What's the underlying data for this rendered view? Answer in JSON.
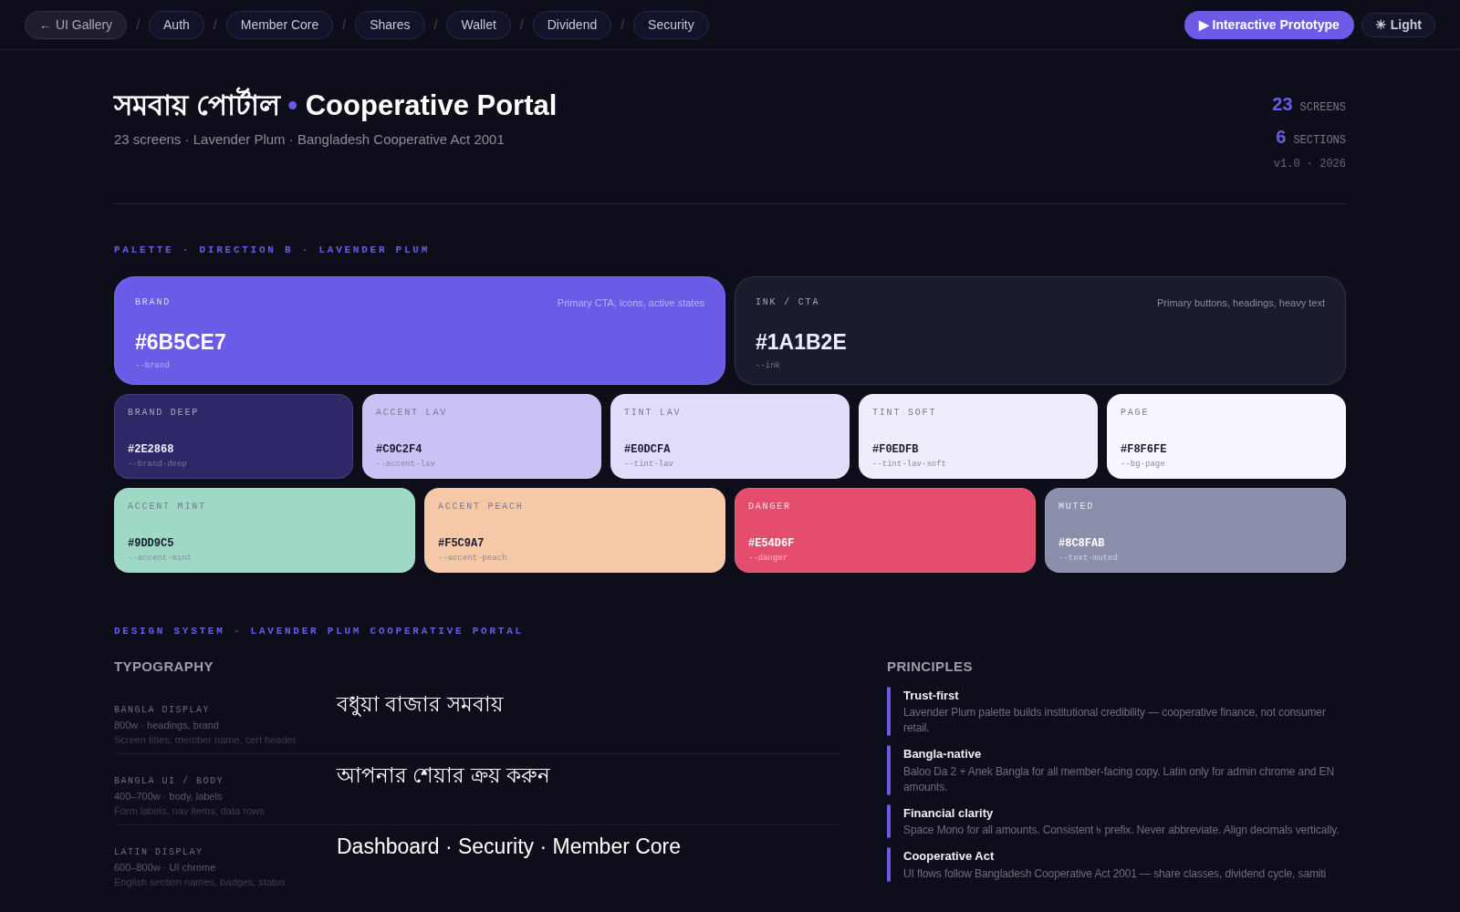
{
  "nav": {
    "items": [
      {
        "kind": "back",
        "label": "← UI Gallery"
      },
      {
        "kind": "sep",
        "label": "/"
      },
      {
        "kind": "link",
        "label": "Auth"
      },
      {
        "kind": "sep",
        "label": "/"
      },
      {
        "kind": "link",
        "label": "Member Core"
      },
      {
        "kind": "sep",
        "label": "/"
      },
      {
        "kind": "link",
        "label": "Shares"
      },
      {
        "kind": "sep",
        "label": "/"
      },
      {
        "kind": "link",
        "label": "Wallet"
      },
      {
        "kind": "sep",
        "label": "/"
      },
      {
        "kind": "link",
        "label": "Dividend"
      },
      {
        "kind": "sep",
        "label": "/"
      },
      {
        "kind": "link",
        "label": "Security"
      }
    ],
    "prototype_button": {
      "icon": "▶",
      "label": "Interactive Prototype"
    },
    "theme_button": {
      "icon": "☀",
      "label": "Light"
    }
  },
  "header": {
    "title_bangla": "সমবায় পোর্টাল",
    "title_dot": "•",
    "title_latin": "Cooperative Portal",
    "subtitle": "23 screens · Lavender Plum · Bangladesh Cooperative Act 2001",
    "stats": [
      {
        "value": "23",
        "label": "SCREENS"
      },
      {
        "value": "6",
        "label": "SECTIONS"
      }
    ],
    "version": "v1.0 · 2026"
  },
  "palette": {
    "heading": "PALETTE · DIRECTION B · LAVENDER PLUM",
    "primary_swatches": [
      {
        "name": "BRAND",
        "hex": "#6B5CE7",
        "var": "--brand",
        "note": "Primary CTA, icons, active states",
        "color": "#6b5ce7",
        "kind": "brand"
      },
      {
        "name": "INK / CTA",
        "hex": "#1A1B2E",
        "var": "--ink",
        "note": "Primary buttons, headings, heavy text",
        "color": "#1a1b2e",
        "kind": "dark"
      }
    ],
    "tint_swatches": [
      {
        "name": "BRAND DEEP",
        "hex": "#2E2868",
        "var": "--brand-deep",
        "color": "#2e2868",
        "kind": "dark"
      },
      {
        "name": "ACCENT LAV",
        "hex": "#C9C2F4",
        "var": "--accent-lav",
        "color": "#c9c2f4",
        "kind": "light"
      },
      {
        "name": "TINT LAV",
        "hex": "#E0DCFA",
        "var": "--tint-lav",
        "color": "#e0dcfa",
        "kind": "light"
      },
      {
        "name": "TINT SOFT",
        "hex": "#F0EDFB",
        "var": "--tint-lav-soft",
        "color": "#f0edfb",
        "kind": "light"
      },
      {
        "name": "PAGE",
        "hex": "#F8F6FE",
        "var": "--bg-page",
        "color": "#f8f6fe",
        "kind": "light"
      }
    ],
    "accent_swatches": [
      {
        "name": "ACCENT MINT",
        "hex": "#9DD9C5",
        "var": "--accent-mint",
        "color": "#9dd9c5",
        "kind": "light"
      },
      {
        "name": "ACCENT PEACH",
        "hex": "#F5C9A7",
        "var": "--accent-peach",
        "color": "#f5c9a7",
        "kind": "light"
      },
      {
        "name": "DANGER",
        "hex": "#E54D6F",
        "var": "--danger",
        "color": "#e54d6f",
        "kind": "bright"
      },
      {
        "name": "MUTED",
        "hex": "#8C8FAB",
        "var": "--text-muted",
        "color": "#8c8fab",
        "kind": "bright"
      }
    ]
  },
  "design_system": {
    "heading": "DESIGN SYSTEM · LAVENDER PLUM COOPERATIVE PORTAL",
    "typography": {
      "heading": "TYPOGRAPHY",
      "rows": [
        {
          "label": "BANGLA DISPLAY",
          "weights": "800w · headings, brand",
          "usage": "Screen titles, member name, cert header",
          "sample": "বধুয়া বাজার সমবায়"
        },
        {
          "label": "BANGLA UI / BODY",
          "weights": "400–700w · body, labels",
          "usage": "Form labels, nav items, data rows",
          "sample": "আপনার শেয়ার ক্রয় করুন"
        },
        {
          "label": "LATIN DISPLAY",
          "weights": "600–800w · UI chrome",
          "usage": "English section names, badges, status",
          "sample": "Dashboard · Security · Member Core"
        }
      ]
    },
    "principles": {
      "heading": "PRINCIPLES",
      "items": [
        {
          "title": "Trust-first",
          "text": "Lavender Plum palette builds institutional credibility — cooperative finance, not consumer retail."
        },
        {
          "title": "Bangla-native",
          "text": "Baloo Da 2 + Anek Bangla for all member-facing copy. Latin only for admin chrome and EN amounts."
        },
        {
          "title": "Financial clarity",
          "text": "Space Mono for all amounts. Consistent ৳ prefix. Never abbreviate. Align decimals vertically."
        },
        {
          "title": "Cooperative Act",
          "text": "UI flows follow Bangladesh Cooperative Act 2001 — share classes, dividend cycle, samiti"
        }
      ]
    }
  }
}
